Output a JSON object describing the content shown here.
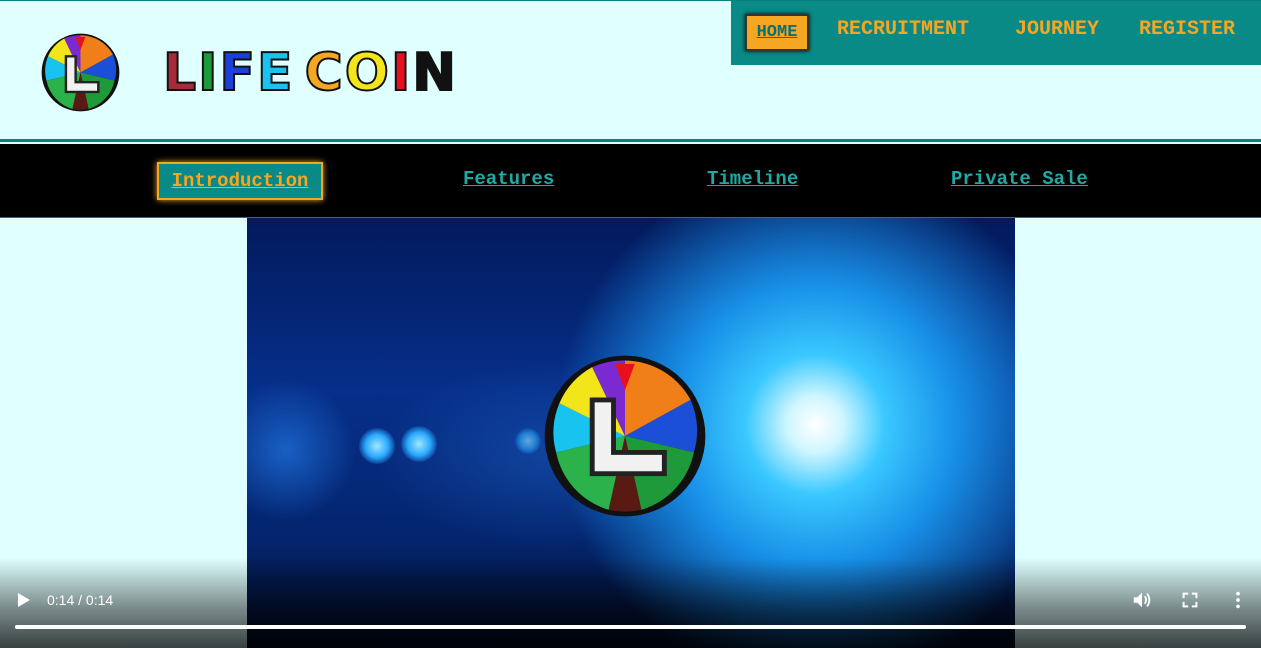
{
  "brand": {
    "logo_icon": "lotus-l-logo-icon",
    "wordmark": "LIFE COIN",
    "wordmark_letters": [
      {
        "char": "L",
        "color": "#a52a3a"
      },
      {
        "char": "I",
        "color": "#1e9a3a"
      },
      {
        "char": "F",
        "color": "#1b3fd8"
      },
      {
        "char": "E",
        "color": "#19c3f0"
      },
      {
        "char": " ",
        "color": "#000000"
      },
      {
        "char": "C",
        "color": "#f5a623"
      },
      {
        "char": "O",
        "color": "#f2e61a"
      },
      {
        "char": "I",
        "color": "#e8101e"
      },
      {
        "char": "N",
        "color": "#111111"
      }
    ]
  },
  "top_nav": {
    "items": [
      {
        "label": "HOME",
        "active": true
      },
      {
        "label": "RECRUITMENT"
      },
      {
        "label": "JOURNEY"
      },
      {
        "label": "REGISTER"
      }
    ]
  },
  "sub_nav": {
    "items": [
      {
        "label": "Introduction",
        "active": true
      },
      {
        "label": "Features"
      },
      {
        "label": "Timeline"
      },
      {
        "label": "Private Sale"
      }
    ]
  },
  "video": {
    "time_display": "0:14 / 0:14",
    "progress": 1.0,
    "icons": {
      "play": "play-icon",
      "volume": "volume-icon",
      "fullscreen": "fullscreen-icon",
      "more": "more-options-icon"
    }
  },
  "colors": {
    "page_bg": "#e0ffff",
    "teal": "#0a8a86",
    "orange": "#f5a623",
    "nav_black": "#000000"
  }
}
